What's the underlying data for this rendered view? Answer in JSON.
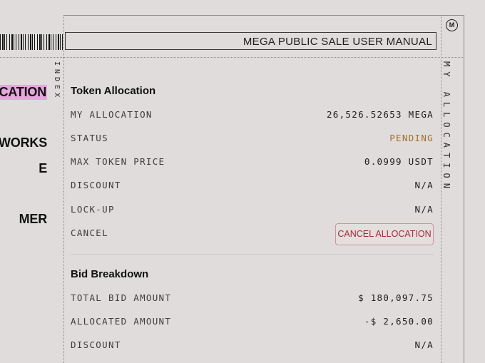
{
  "header": {
    "title": "MEGA PUBLIC SALE USER MANUAL",
    "logo_text": "M"
  },
  "index_label": "INDEX",
  "side_label": "MY ALLOCATION",
  "nav": {
    "items": [
      {
        "label": "OCATION",
        "active": true
      },
      {
        "label": "WORKS",
        "active": false
      },
      {
        "label": "E",
        "active": false
      },
      {
        "label": "MER",
        "active": false
      }
    ]
  },
  "token_allocation": {
    "title": "Token Allocation",
    "rows": [
      {
        "label": "MY ALLOCATION",
        "value": "26,526.52653 MEGA"
      },
      {
        "label": "STATUS",
        "value": "PENDING"
      },
      {
        "label": "MAX TOKEN PRICE",
        "value": "0.0999 USDT"
      },
      {
        "label": "DISCOUNT",
        "value": "N/A"
      },
      {
        "label": "LOCK-UP",
        "value": "N/A"
      },
      {
        "label": "CANCEL",
        "value": ""
      }
    ],
    "cancel_button": "CANCEL ALLOCATION"
  },
  "bid_breakdown": {
    "title": "Bid Breakdown",
    "rows": [
      {
        "label": "TOTAL BID AMOUNT",
        "value": "$ 180,097.75"
      },
      {
        "label": "ALLOCATED AMOUNT",
        "value": "-$ 2,650.00"
      },
      {
        "label": "DISCOUNT",
        "value": "N/A"
      }
    ]
  },
  "colors": {
    "background": "#dfdcdb",
    "accent_highlight": "#e7a6dc",
    "pending": "#a66f25",
    "cancel": "#a32a3b"
  }
}
